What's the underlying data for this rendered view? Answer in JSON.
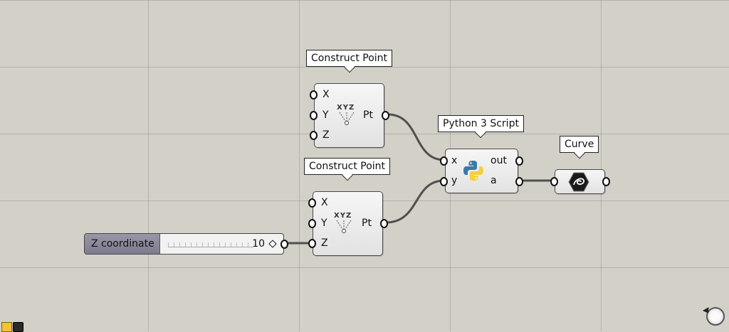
{
  "components": {
    "construct_point_1": {
      "title": "Construct Point",
      "inputs": [
        "X",
        "Y",
        "Z"
      ],
      "output": "Pt"
    },
    "construct_point_2": {
      "title": "Construct Point",
      "inputs": [
        "X",
        "Y",
        "Z"
      ],
      "output": "Pt"
    },
    "python_script": {
      "title": "Python 3 Script",
      "inputs": [
        "x",
        "y"
      ],
      "outputs": [
        "out",
        "a"
      ]
    },
    "curve": {
      "title": "Curve"
    }
  },
  "slider": {
    "label": "Z coordinate",
    "value": "10"
  },
  "icons": {
    "xyz_label": "XYZ",
    "construct_point": "construct-point-icon",
    "python": "python-icon",
    "curve": "curve-icon"
  }
}
